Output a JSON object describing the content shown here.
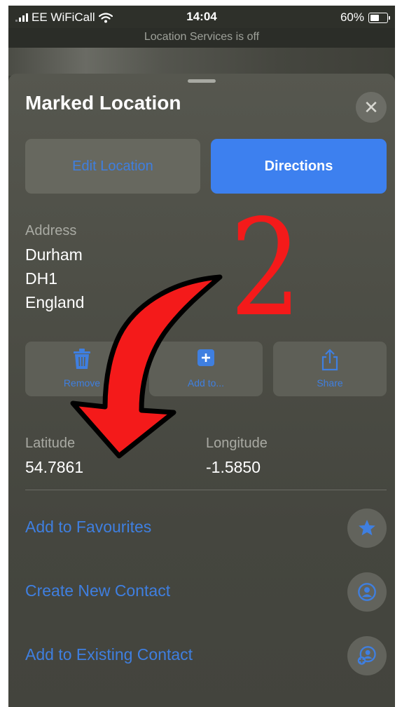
{
  "status_bar": {
    "carrier": "EE WiFiCall",
    "time": "14:04",
    "battery": "60%",
    "battery_level": 0.6
  },
  "location_banner": "Location Services is off",
  "sheet": {
    "title": "Marked Location",
    "close_icon": "close-icon",
    "buttons": {
      "edit_location": "Edit Location",
      "directions": "Directions"
    },
    "address": {
      "label": "Address",
      "lines": [
        "Durham",
        "DH1",
        "England"
      ]
    },
    "actions": [
      {
        "label": "Remove",
        "icon": "trash-icon"
      },
      {
        "label": "Add to...",
        "icon": "add-square-icon"
      },
      {
        "label": "Share",
        "icon": "share-icon"
      }
    ],
    "coordinates": {
      "latitude_label": "Latitude",
      "latitude_value": "54.7861",
      "longitude_label": "Longitude",
      "longitude_value": "-1.5850"
    },
    "options": [
      {
        "label": "Add to Favourites",
        "icon": "star-icon"
      },
      {
        "label": "Create New Contact",
        "icon": "contact-icon"
      },
      {
        "label": "Add to Existing Contact",
        "icon": "add-contact-icon"
      }
    ]
  },
  "annotation": {
    "step_number": "2",
    "arrow_color": "#f41a1a"
  },
  "colors": {
    "accent": "#3d80ef",
    "link": "#3f7fe0",
    "sheet": "#4d4e46"
  }
}
